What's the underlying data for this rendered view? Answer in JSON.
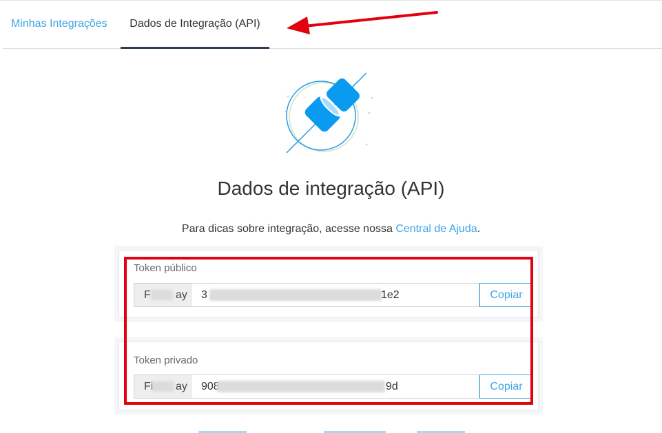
{
  "tabs": [
    {
      "label": "Minhas Integrações"
    },
    {
      "label": "Dados de Integração (API)"
    }
  ],
  "main": {
    "title": "Dados de integração (API)",
    "hint_prefix": "Para dicas sobre integração, acesse nossa ",
    "hint_link": "Central de Ajuda",
    "hint_suffix": "."
  },
  "tokens": [
    {
      "label": "Token público",
      "prefix_start": "F",
      "prefix_end": "ay",
      "value_start": "3",
      "value_end": "1e2",
      "copy_label": "Copiar"
    },
    {
      "label": "Token privado",
      "prefix_start": "Fi",
      "prefix_end": "ay",
      "value_start": "908",
      "value_end": "9d",
      "copy_label": "Copiar"
    }
  ],
  "colors": {
    "accent": "#3ea6e6",
    "annotation_red": "#e3000f",
    "tab_underline": "#2c3e50"
  },
  "icons": [
    "plug-connection-icon",
    "annotation-arrow-icon"
  ]
}
